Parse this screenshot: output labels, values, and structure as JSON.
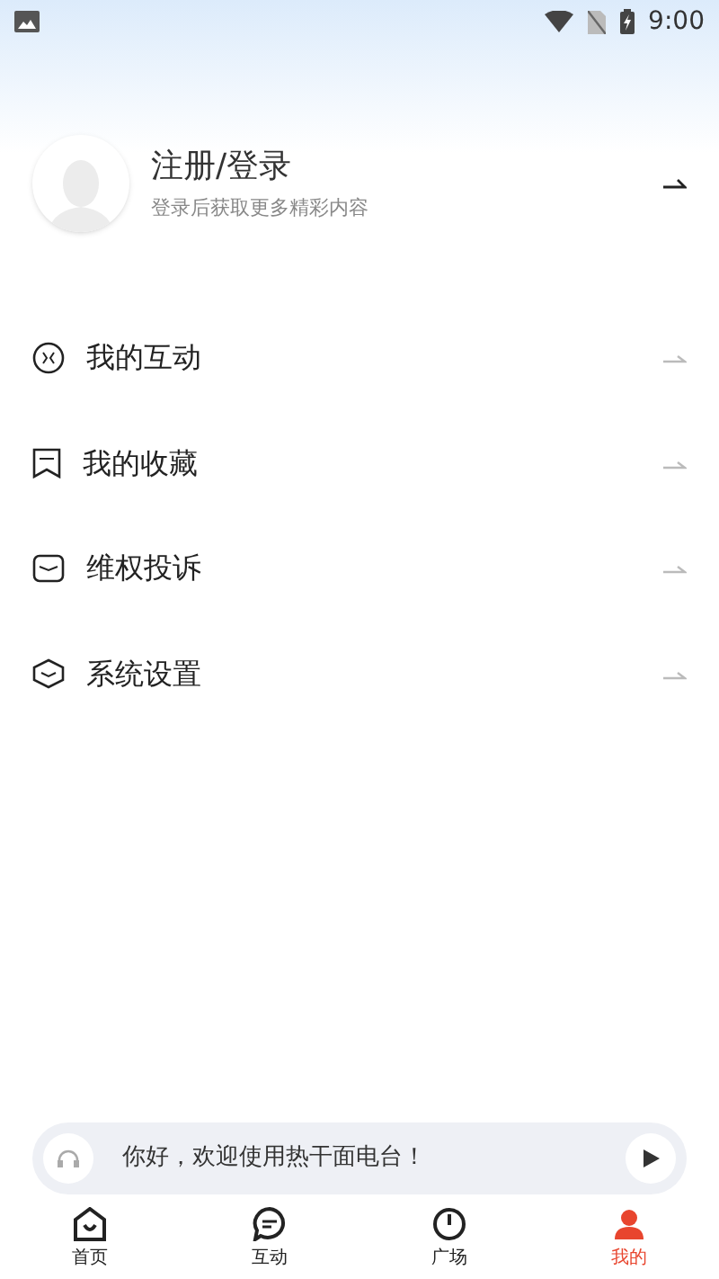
{
  "status_bar": {
    "time": "9:00"
  },
  "profile": {
    "title": "注册/登录",
    "subtitle": "登录后获取更多精彩内容"
  },
  "menu": [
    {
      "kind": "interact",
      "label": "我的互动"
    },
    {
      "kind": "bookmark",
      "label": "我的收藏"
    },
    {
      "kind": "complaint",
      "label": "维权投诉"
    },
    {
      "kind": "settings",
      "label": "系统设置"
    }
  ],
  "player": {
    "message": "你好，欢迎使用热干面电台！"
  },
  "tabs": [
    {
      "kind": "home",
      "label": "首页",
      "selected": false
    },
    {
      "kind": "chat",
      "label": "互动",
      "selected": false
    },
    {
      "kind": "plaza",
      "label": "广场",
      "selected": false
    },
    {
      "kind": "me",
      "label": "我的",
      "selected": true
    }
  ]
}
